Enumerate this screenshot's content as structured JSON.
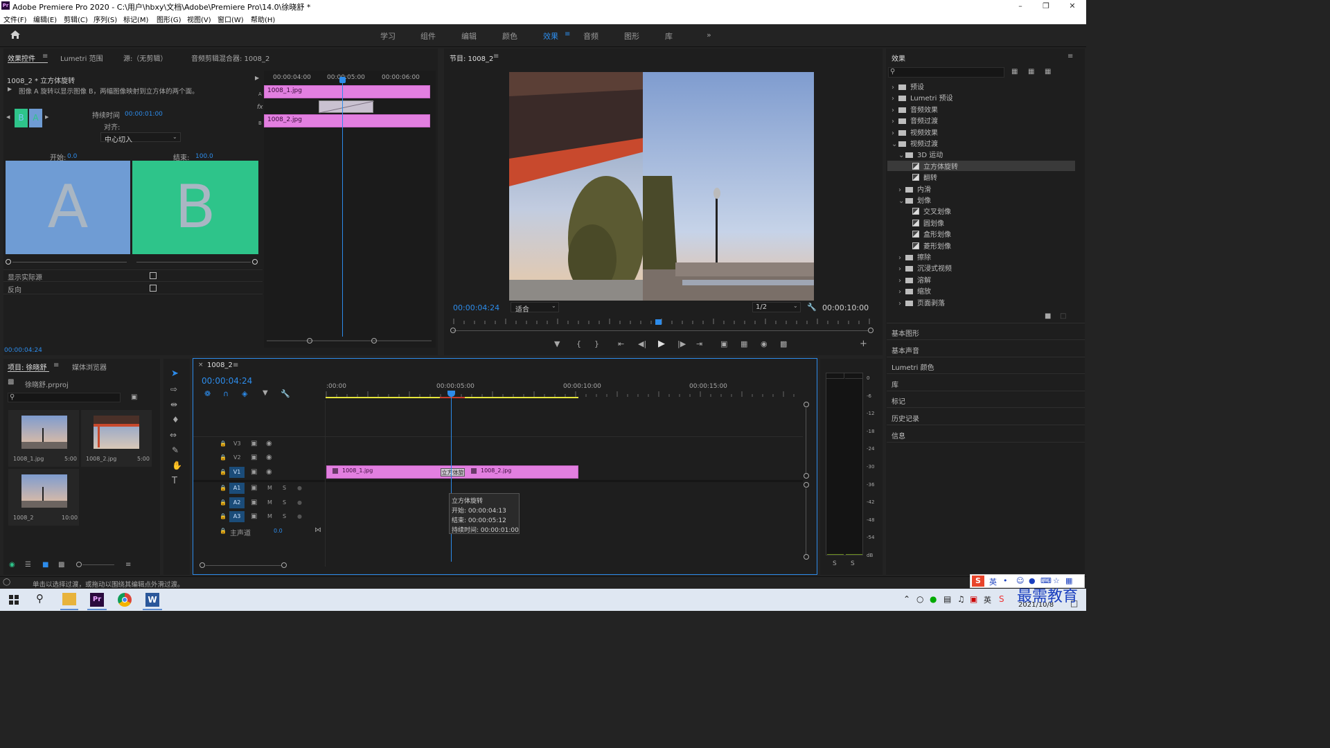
{
  "title_bar": {
    "text": "Adobe Premiere Pro 2020 - C:\\用户\\hbxy\\文档\\Adobe\\Premiere Pro\\14.0\\徐晓舒 *"
  },
  "menu": [
    "文件(F)",
    "编辑(E)",
    "剪辑(C)",
    "序列(S)",
    "标记(M)",
    "图形(G)",
    "视图(V)",
    "窗口(W)",
    "帮助(H)"
  ],
  "workspaces": [
    "学习",
    "组件",
    "编辑",
    "颜色",
    "效果",
    "音频",
    "图形",
    "库"
  ],
  "active_workspace": "效果",
  "effect_controls": {
    "tabs": [
      "效果控件",
      "Lumetri 范围",
      "源:（无剪辑）",
      "音频剪辑混合器: 1008_2"
    ],
    "clip_name": "1008_2 * 立方体旋转",
    "description": "图像 A 旋转以显示图像 B，两幅图像映射到立方体的两个面。",
    "duration_label": "持续时间",
    "duration_value": "00:00:01:00",
    "align_label": "对齐:",
    "align_value": "中心切入",
    "start_label": "开始:",
    "start_value": "0.0",
    "end_label": "结束:",
    "end_value": "100.0",
    "preview_a": "A",
    "preview_b": "B",
    "mini_a": "B",
    "mini_b": "A",
    "show_actual": "显示实际源",
    "reverse": "反向",
    "timecode": "00:00:04:24",
    "ruler": [
      "00:00:04:00",
      "00:00:05:00",
      "00:00:06:00"
    ],
    "track_a": "A",
    "track_b": "B",
    "fx": "fx",
    "clip1": "1008_1.jpg",
    "clip2": "1008_2.jpg"
  },
  "program_monitor": {
    "title": "节目: 1008_2",
    "timecode": "00:00:04:24",
    "fit": "适合",
    "resolution": "1/2",
    "duration": "00:00:10:00",
    "playhead_fraction": 0.49
  },
  "effects_panel": {
    "title": "效果",
    "items": [
      {
        "label": "预设",
        "level": 0,
        "kind": "folder",
        "open": false
      },
      {
        "label": "Lumetri 预设",
        "level": 0,
        "kind": "folder",
        "open": false
      },
      {
        "label": "音频效果",
        "level": 0,
        "kind": "folder",
        "open": false
      },
      {
        "label": "音频过渡",
        "level": 0,
        "kind": "folder",
        "open": false
      },
      {
        "label": "视频效果",
        "level": 0,
        "kind": "folder",
        "open": false
      },
      {
        "label": "视频过渡",
        "level": 0,
        "kind": "folder",
        "open": true
      },
      {
        "label": "3D 运动",
        "level": 1,
        "kind": "folder",
        "open": true
      },
      {
        "label": "立方体旋转",
        "level": 2,
        "kind": "preset",
        "selected": true
      },
      {
        "label": "翻转",
        "level": 2,
        "kind": "preset"
      },
      {
        "label": "内滑",
        "level": 1,
        "kind": "folder",
        "open": false
      },
      {
        "label": "划像",
        "level": 1,
        "kind": "folder",
        "open": true
      },
      {
        "label": "交叉划像",
        "level": 2,
        "kind": "preset"
      },
      {
        "label": "圆划像",
        "level": 2,
        "kind": "preset"
      },
      {
        "label": "盒形划像",
        "level": 2,
        "kind": "preset"
      },
      {
        "label": "菱形划像",
        "level": 2,
        "kind": "preset"
      },
      {
        "label": "擦除",
        "level": 1,
        "kind": "folder",
        "open": false
      },
      {
        "label": "沉浸式视频",
        "level": 1,
        "kind": "folder",
        "open": false
      },
      {
        "label": "溶解",
        "level": 1,
        "kind": "folder",
        "open": false
      },
      {
        "label": "缩放",
        "level": 1,
        "kind": "folder",
        "open": false
      },
      {
        "label": "页面剥落",
        "level": 1,
        "kind": "folder",
        "open": false
      }
    ],
    "side_panels": [
      "基本图形",
      "基本声音",
      "Lumetri 颜色",
      "库",
      "标记",
      "历史记录",
      "信息"
    ]
  },
  "project": {
    "tabs": [
      "项目: 徐晓舒",
      "媒体浏览器"
    ],
    "file": "徐晓舒.prproj",
    "items": [
      {
        "name": "1008_1.jpg",
        "dur": "5:00"
      },
      {
        "name": "1008_2.jpg",
        "dur": "5:00"
      },
      {
        "name": "1008_2",
        "dur": "10:00"
      }
    ]
  },
  "timeline": {
    "tab": "1008_2",
    "timecode": "00:00:04:24",
    "ruler": [
      ":00:00",
      "00:00:05:00",
      "00:00:10:00",
      "00:00:15:00"
    ],
    "video_tracks": [
      "V3",
      "V2",
      "V1"
    ],
    "audio_tracks": [
      "A1",
      "A2",
      "A3"
    ],
    "master": "主声道",
    "master_value": "0.0",
    "clip1": "1008_1.jpg",
    "clip2": "1008_2.jpg",
    "transition": "立方体旋",
    "tooltip": [
      "立方体旋转",
      "开始: 00:00:04:13",
      "结束: 00:00:05:12",
      "持续时间: 00:00:01:00"
    ]
  },
  "meter_scale": [
    "0",
    "-6",
    "-12",
    "-18",
    "-24",
    "-30",
    "-36",
    "-42",
    "-48",
    "-54",
    "dB"
  ],
  "meter_solo": [
    "S",
    "S"
  ],
  "status_text": "单击以选择过渡，或拖动以围绕其编辑点外滑过渡。",
  "taskbar": {
    "date": "2021/10/8",
    "watermark": "最需教育",
    "ime": "英"
  },
  "colors": {
    "accent": "#2d8ceb",
    "clip": "#e27fe0",
    "panel": "#1e1e1e"
  }
}
